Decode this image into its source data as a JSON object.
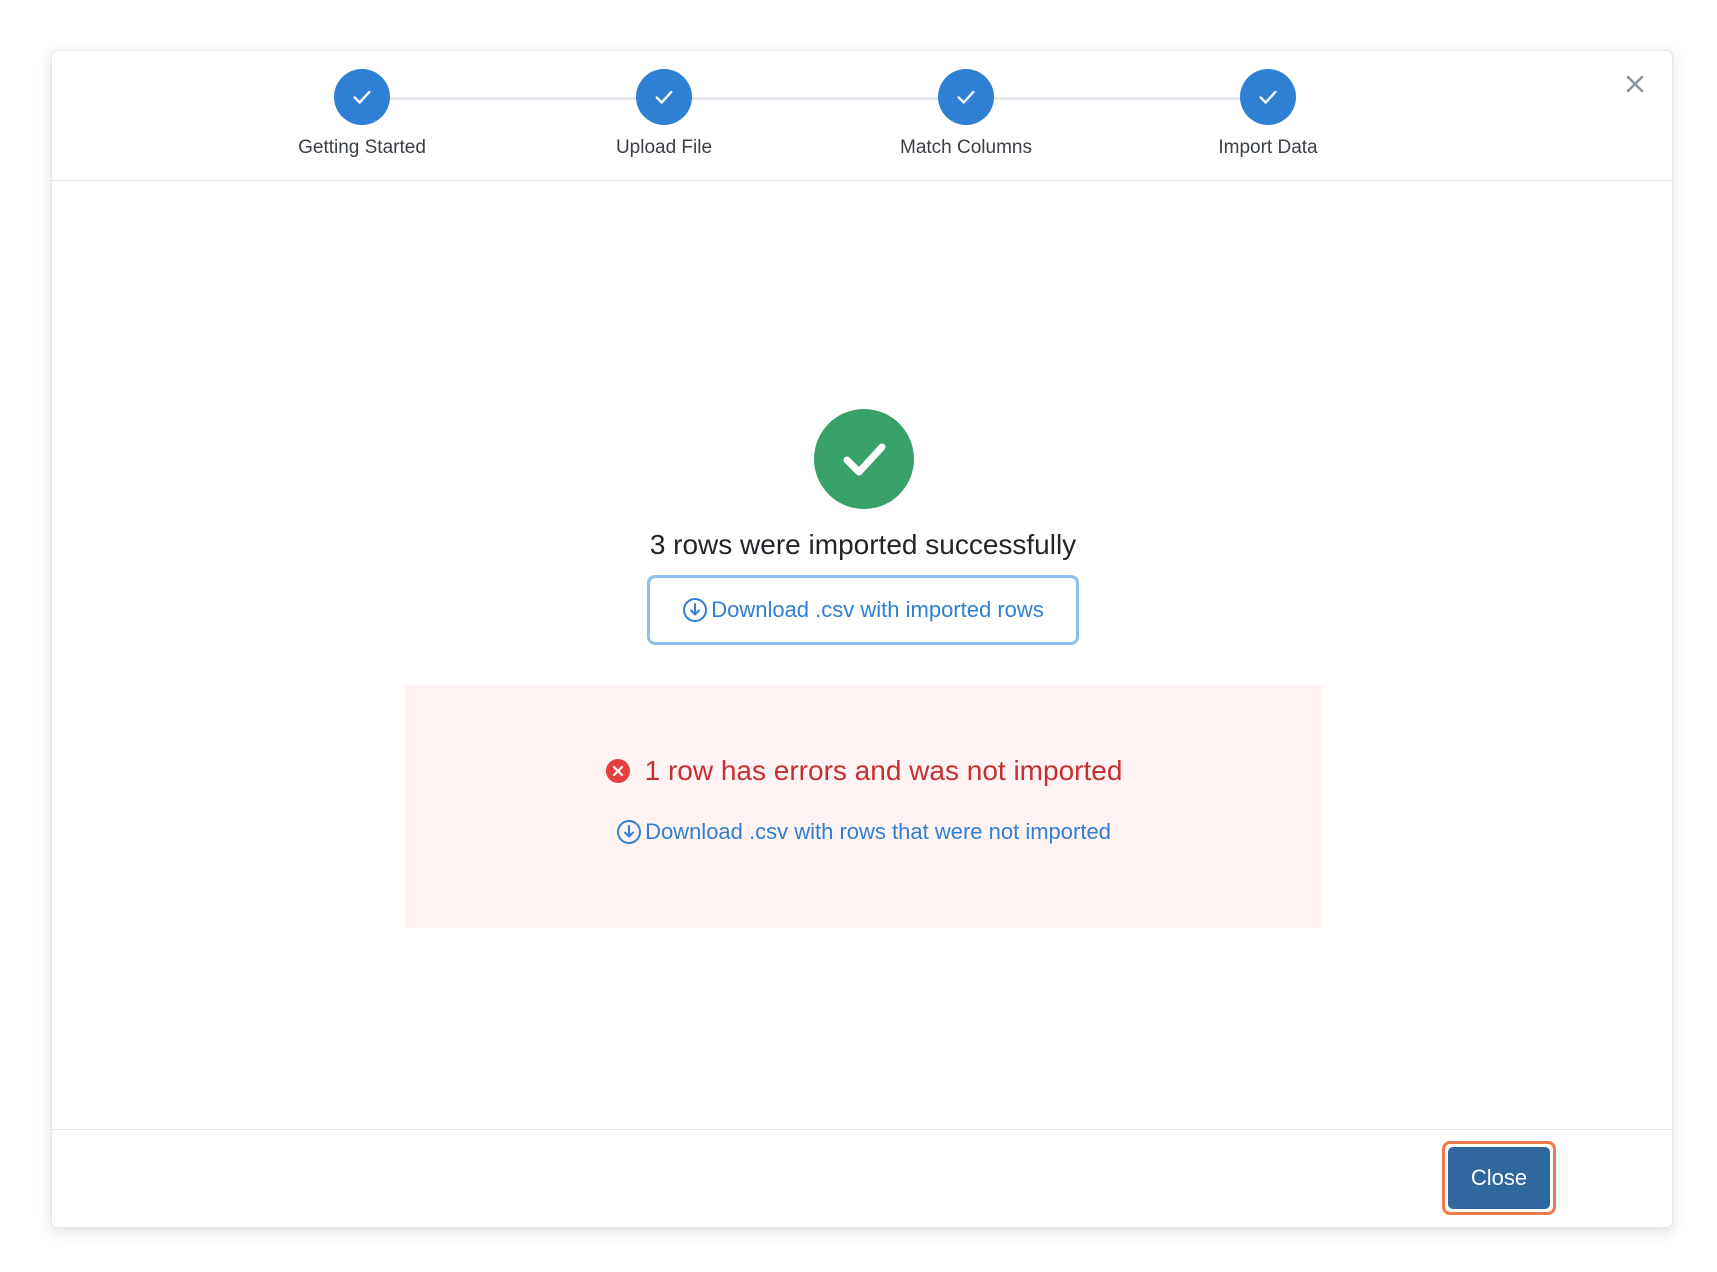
{
  "steps": [
    {
      "label": "Getting Started",
      "done": true
    },
    {
      "label": "Upload File",
      "done": true
    },
    {
      "label": "Match Columns",
      "done": true
    },
    {
      "label": "Import Data",
      "done": true
    }
  ],
  "result": {
    "success_message": "3 rows were imported successfully",
    "download_imported_label": "Download .csv with imported rows",
    "error_message": "1 row has errors and was not imported",
    "download_errors_label": "Download .csv with rows that were not imported"
  },
  "footer": {
    "close_label": "Close"
  },
  "colors": {
    "step_active": "#2f7fd4",
    "success": "#38a169",
    "error": "#c53030",
    "error_bg": "#fff3f3",
    "link": "#2f7fd4",
    "primary_button": "#2f679f",
    "focus_ring": "#ef7a4b"
  },
  "icons": {
    "dialog_close": "close-icon",
    "step_done": "check-icon",
    "success": "check-circle-icon",
    "error": "x-circle-icon",
    "download": "download-circle-icon"
  }
}
